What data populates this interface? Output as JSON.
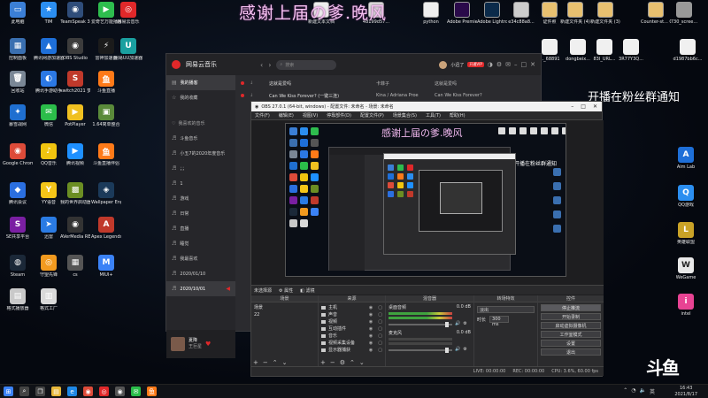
{
  "overlay": {
    "title": "感谢上届の爹.晚风",
    "right_note": "开播在粉丝群通知"
  },
  "desktop": {
    "left_icons": [
      {
        "label": "此电脑",
        "color": "#3b7fd6",
        "glyph": "▭"
      },
      {
        "label": "TIM",
        "color": "#2b8ef0",
        "glyph": "★"
      },
      {
        "label": "TeamSpeak 3",
        "color": "#2f4d7a",
        "glyph": "◉"
      },
      {
        "label": "爱奇艺万能播放器",
        "color": "#2ebd4e",
        "glyph": "▶"
      },
      {
        "label": "网易云音乐",
        "color": "#e0282a",
        "glyph": "◎"
      },
      {
        "label": "控制面板",
        "color": "#3a6fb0",
        "glyph": "▦"
      },
      {
        "label": "腾讯网游加速器",
        "color": "#1e6fd8",
        "glyph": "▲"
      },
      {
        "label": "OBS Studio",
        "color": "#3c3c3c",
        "glyph": "◉"
      },
      {
        "label": "雷神加速器",
        "color": "#1b1b1b",
        "glyph": "⚡"
      },
      {
        "label": "网易UU加速器",
        "color": "#1aa0a0",
        "glyph": "U"
      },
      {
        "label": "回收站",
        "color": "#7a8796",
        "glyph": "🗑"
      },
      {
        "label": "腾讯手游助手",
        "color": "#2b78e4",
        "glyph": "◐"
      },
      {
        "label": "switch2021 梦想版",
        "color": "#c0392b",
        "glyph": "S"
      },
      {
        "label": "斗鱼直播",
        "color": "#ff7a18",
        "glyph": "鱼"
      },
      {
        "label": "暴雪战网",
        "color": "#1f6fd0",
        "glyph": "✦"
      },
      {
        "label": "微信",
        "color": "#2bbd4a",
        "glyph": "✉"
      },
      {
        "label": "PotPlayer",
        "color": "#f0c020",
        "glyph": "▶"
      },
      {
        "label": "1.64简单整合",
        "color": "#5a8a3a",
        "glyph": "▣"
      },
      {
        "label": "Google Chrome",
        "color": "#dd4b39",
        "glyph": "◉"
      },
      {
        "label": "QQ音乐",
        "color": "#f1c40f",
        "glyph": "♪"
      },
      {
        "label": "腾讯视频",
        "color": "#1e90ff",
        "glyph": "▶"
      },
      {
        "label": "斗鱼直播伴侣",
        "color": "#ff7a18",
        "glyph": "鱼"
      },
      {
        "label": "腾讯会议",
        "color": "#2b6fe0",
        "glyph": "◆"
      },
      {
        "label": "YY语音",
        "color": "#f5c518",
        "glyph": "Y"
      },
      {
        "label": "我的世界启动器",
        "color": "#6b8e23",
        "glyph": "▩"
      },
      {
        "label": "Wallpaper Engine",
        "color": "#1b3a5a",
        "glyph": "◈"
      },
      {
        "label": "SE共享平台",
        "color": "#7a1fa2",
        "glyph": "S"
      },
      {
        "label": "迅雷",
        "color": "#2a7be4",
        "glyph": "➤"
      },
      {
        "label": "AVerMedia RECentral 4",
        "color": "#333333",
        "glyph": "◉"
      },
      {
        "label": "Apex Legends",
        "color": "#c0392b",
        "glyph": "A"
      },
      {
        "label": "Steam",
        "color": "#1b2838",
        "glyph": "◍"
      },
      {
        "label": "守望先锋",
        "color": "#f29a1f",
        "glyph": "◎"
      },
      {
        "label": "cs",
        "color": "#555555",
        "glyph": "▦"
      },
      {
        "label": "MIUI+",
        "color": "#3b82f6",
        "glyph": "M"
      },
      {
        "label": "格式播放器",
        "color": "#c9c9c9",
        "glyph": "▤"
      },
      {
        "label": "格式工厂",
        "color": "#d9d9d9",
        "glyph": "▥"
      }
    ],
    "top_files": [
      {
        "label": "新建文本文档",
        "color": "#eeeeee"
      },
      {
        "label": "48199d57...",
        "color": "#dddddd"
      },
      {
        "label": "python",
        "color": "#eeeeee"
      },
      {
        "label": "Adobe Premie...",
        "color": "#2a0a4a"
      },
      {
        "label": "Adobe Lightroo...",
        "color": "#0b2a4a"
      },
      {
        "label": "e34c88a8...",
        "color": "#cccccc"
      },
      {
        "label": "证件照",
        "color": "#e8c070"
      },
      {
        "label": "新建文件夹 (4)",
        "color": "#e8c070"
      },
      {
        "label": "新建文件夹 (3)",
        "color": "#e8c070"
      },
      {
        "label": "Counter-st... Global Of...",
        "color": "#e8c070"
      },
      {
        "label": "730_scree...",
        "color": "#999999"
      }
    ],
    "mid_files": [
      {
        "label": "..._68891"
      },
      {
        "label": "dongbeix..."
      },
      {
        "label": "83I_URL..."
      },
      {
        "label": "3R77Y3Q..."
      },
      {
        "label": "d1987bb6c..."
      }
    ],
    "right_icons": [
      {
        "label": "Aim Lab",
        "color": "#1e6fd8",
        "glyph": "A"
      },
      {
        "label": "QQ游戏",
        "color": "#2b8ef0",
        "glyph": "Q"
      },
      {
        "label": "英雄联盟",
        "color": "#c9a227",
        "glyph": "L"
      },
      {
        "label": "WeGame",
        "color": "#e8e8e8",
        "glyph": "W"
      },
      {
        "label": "intel",
        "color": "#e84393",
        "glyph": "i"
      }
    ]
  },
  "music_app": {
    "name": "网易云音乐",
    "search_placeholder": "搜索",
    "user": "小迅了",
    "vip": "开通VIP",
    "sidebar": [
      {
        "label": "我的播客",
        "active": true
      },
      {
        "label": "我的收藏",
        "active": false
      }
    ],
    "created_header": "我喜欢的音乐",
    "playlists": [
      "斗鱼音乐",
      "小五7的2020年度音乐",
      "；；",
      "1",
      "游戏",
      "日常",
      "直播",
      "睡觉",
      "我最喜欢",
      "2020/01/10",
      "2020/10/01"
    ],
    "tracks": [
      {
        "title": "这就是爱吗",
        "artist": "卡菲子",
        "album": "这就是爱吗"
      },
      {
        "title": "Can We Kiss Forever? (一键三连)",
        "artist": "Kina / Adriana Proe",
        "album": "Can We Kiss Forever?"
      }
    ],
    "now_playing": {
      "title": "夏降",
      "artist": "王巨星"
    }
  },
  "obs": {
    "window_title": "OBS 27.0.1 (64-bit, windows) - 配置文件: 未命名 - 场景: 未命名",
    "menu": [
      "文件(F)",
      "编辑(E)",
      "视图(V)",
      "停靠部件(D)",
      "配置文件(P)",
      "场景集合(S)",
      "工具(T)",
      "帮助(H)"
    ],
    "subbar": {
      "source_label": "未选择源",
      "properties": "属性",
      "filters": "滤镜"
    },
    "docks": {
      "scenes": "场景",
      "sources": "来源",
      "mixer": "混音器",
      "transitions": "转场特效",
      "controls": "控件"
    },
    "scene_items": [
      "场景",
      "22"
    ],
    "source_items": [
      "主机",
      "声音",
      "视频",
      "互动插件",
      "音乐",
      "视频采集设备",
      "显示器捕获"
    ],
    "mixer_items": [
      {
        "label": "桌面音频",
        "value": "0.0 dB"
      },
      {
        "label": "麦克风",
        "value": "0.0 dB"
      }
    ],
    "transition_select": "淡出",
    "duration_label": "时长",
    "duration_value": "300 ms",
    "controls": [
      {
        "label": "停止推流",
        "active": true
      },
      {
        "label": "开始录制",
        "active": false
      },
      {
        "label": "启动虚拟摄像机",
        "active": false
      },
      {
        "label": "工作室模式",
        "active": false
      },
      {
        "label": "设置",
        "active": false
      },
      {
        "label": "退出",
        "active": false
      }
    ],
    "status": {
      "live": "LIVE: 00:00:00",
      "rec": "REC: 00:00:00",
      "cpu": "CPU: 3.6%, 60.00 fps"
    }
  },
  "brand": {
    "douyu_logo": "斗鱼"
  },
  "taskbar": {
    "time": "16:43",
    "date": "2021/8/17",
    "lang": "英",
    "icons": [
      {
        "name": "windows-start-icon",
        "glyph": "⊞",
        "color": "#3b82f6"
      },
      {
        "name": "search-icon",
        "glyph": "⌕",
        "color": "#444444"
      },
      {
        "name": "task-view-icon",
        "glyph": "❐",
        "color": "#444444"
      },
      {
        "name": "file-explorer-icon",
        "glyph": "▤",
        "color": "#e8b83a"
      },
      {
        "name": "edge-icon",
        "glyph": "e",
        "color": "#1e88e5"
      },
      {
        "name": "chrome-icon",
        "glyph": "◉",
        "color": "#dd4b39"
      },
      {
        "name": "netease-music-icon",
        "glyph": "◎",
        "color": "#e0282a"
      },
      {
        "name": "obs-icon",
        "glyph": "◉",
        "color": "#555555"
      },
      {
        "name": "wechat-icon",
        "glyph": "✉",
        "color": "#2bbd4a"
      },
      {
        "name": "douyu-icon",
        "glyph": "鱼",
        "color": "#ff7a18"
      }
    ]
  }
}
